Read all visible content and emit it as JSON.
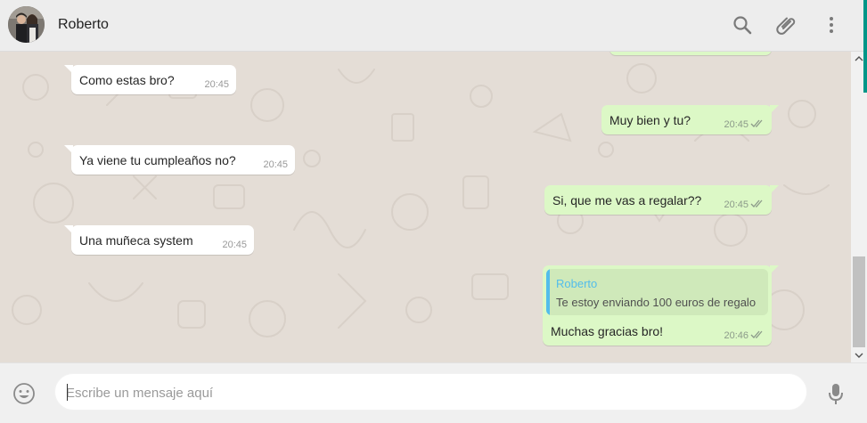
{
  "header": {
    "contact_name": "Roberto"
  },
  "messages": [
    {
      "direction": "incoming",
      "text": "Como estas bro?",
      "time": "20:45"
    },
    {
      "direction": "outgoing",
      "text": "Muy bien y tu?",
      "time": "20:45",
      "status": "read"
    },
    {
      "direction": "incoming",
      "text": "Ya viene tu cumpleaños no?",
      "time": "20:45"
    },
    {
      "direction": "outgoing",
      "text": "Si, que me vas a regalar??",
      "time": "20:45",
      "status": "read"
    },
    {
      "direction": "incoming",
      "text": "Una muñeca system",
      "time": "20:45"
    },
    {
      "direction": "outgoing",
      "text": "Muchas gracias bro!",
      "time": "20:46",
      "status": "read",
      "quoted": {
        "author": "Roberto",
        "text": "Te estoy enviando 100 euros de regalo"
      }
    }
  ],
  "composer": {
    "placeholder": "Escribe un mensaje aquí"
  },
  "icons": {
    "search": "search-icon",
    "attach": "paperclip-icon",
    "menu": "menu-dots-icon",
    "emoji": "emoji-icon",
    "mic": "microphone-icon"
  },
  "colors": {
    "incoming_bubble": "#ffffff",
    "outgoing_bubble": "#dcf8c6",
    "chat_background": "#e4ddd6",
    "read_ticks": "#8c9a8a",
    "quote_author": "#53bdeb",
    "accent": "#009688"
  }
}
